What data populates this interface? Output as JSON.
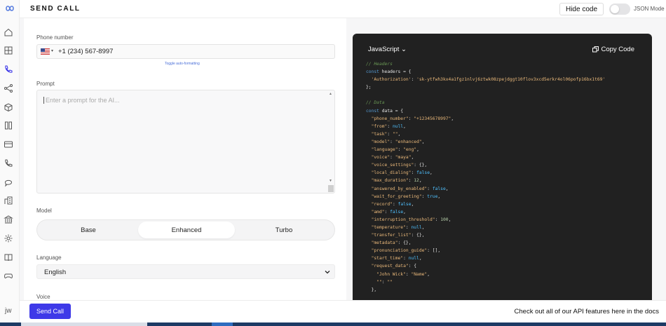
{
  "header": {
    "title": "SEND CALL",
    "hide_code_label": "Hide code",
    "json_mode_label": "JSON Mode"
  },
  "form": {
    "phone_label": "Phone number",
    "phone_value": "+1 (234) 567-8997",
    "toggle_formatting": "Toggle auto-formatting",
    "prompt_label": "Prompt",
    "prompt_placeholder": "Enter a prompt for the AI...",
    "model_label": "Model",
    "models": [
      "Base",
      "Enhanced",
      "Turbo"
    ],
    "model_selected": "Enhanced",
    "language_label": "Language",
    "language_value": "English",
    "voice_label": "Voice"
  },
  "code": {
    "language": "JavaScript",
    "copy_label": "Copy Code",
    "lines": [
      "// Headers",
      "const headers = {",
      "  'Authorization': 'sk-ytfwh3kx4a1fgz1nlvj6ztwk08zpejdggt10flov3xcd5erkr4ol06pofp16bx1t69'",
      "};",
      "",
      "// Data",
      "const data = {",
      "  \"phone_number\": \"+12345678997\",",
      "  \"from\": null,",
      "  \"task\": \"\",",
      "  \"model\": \"enhanced\",",
      "  \"language\": \"eng\",",
      "  \"voice\": \"maya\",",
      "  \"voice_settings\": {},",
      "  \"local_dialing\": false,",
      "  \"max_duration\": 12,",
      "  \"answered_by_enabled\": false,",
      "  \"wait_for_greeting\": true,",
      "  \"record\": false,",
      "  \"amd\": false,",
      "  \"interruption_threshold\": 100,",
      "  \"temperature\": null,",
      "  \"transfer_list\": {},",
      "  \"metadata\": {},",
      "  \"pronunciation_guide\": [],",
      "  \"start_time\": null,",
      "  \"request_data\": {",
      "    \"John Wick\": \"Name\",",
      "    \"\": \"\"",
      "  },"
    ]
  },
  "footer": {
    "send_label": "Send Call",
    "docs_text": "Check out all of our API features here in the docs",
    "user_initials": "jw"
  },
  "colors": {
    "accent": "#3e39e8",
    "code_bg": "#212121"
  },
  "sidebar_icons": [
    "home-icon",
    "grid-icon",
    "phone-icon",
    "share-icon",
    "box-icon",
    "columns-icon",
    "card-icon",
    "phone-outgoing-icon",
    "message-icon",
    "building-icon",
    "bank-icon",
    "settings-icon",
    "book-icon",
    "gamepad-icon"
  ]
}
